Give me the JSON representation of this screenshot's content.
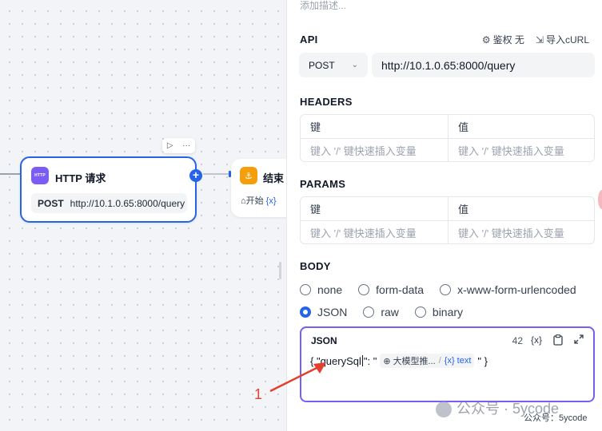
{
  "canvas": {
    "http_node": {
      "icon_label": "HTTP",
      "title": "HTTP 请求",
      "method": "POST",
      "url": "http://10.1.0.65:8000/query",
      "add_label": "+"
    },
    "toolbar": {
      "run": "▷",
      "more": "···"
    },
    "end_node": {
      "icon": "⚓",
      "title": "结束",
      "var_source": "开始",
      "var_tag": "{x}"
    }
  },
  "panel": {
    "description_placeholder": "添加描述...",
    "api": {
      "title": "API",
      "auth_label": "鉴权 无",
      "import_label": "导入cURL",
      "method": "POST",
      "url": "http://10.1.0.65:8000/query"
    },
    "headers": {
      "title": "HEADERS",
      "key_header": "键",
      "value_header": "值",
      "key_placeholder": "键入 '/' 键快速插入变量",
      "value_placeholder": "键入 '/' 键快速插入变量"
    },
    "params": {
      "title": "PARAMS",
      "key_header": "键",
      "value_header": "值",
      "key_placeholder": "键入 '/' 键快速插入变量",
      "value_placeholder": "键入 '/' 键快速插入变量"
    },
    "body": {
      "title": "BODY",
      "options": [
        "none",
        "form-data",
        "x-www-form-urlencoded",
        "JSON",
        "raw",
        "binary"
      ],
      "selected": "JSON",
      "json_editor": {
        "title": "JSON",
        "count": "42",
        "var_icon": "{x}",
        "code_prefix": "{ \"querySql",
        "code_mid": "\": \"",
        "chip_node": "大模型推...",
        "chip_var_tag": "{x}",
        "chip_var": "text",
        "code_suffix": "\" }"
      }
    }
  },
  "annotation": {
    "label": "1",
    "color": "#e53e2e"
  },
  "watermark": {
    "text": "公众号 · 5ycode",
    "text2": "公众号：5ycode"
  },
  "colors": {
    "accent": "#2563eb",
    "purple": "#7c5cf6",
    "end_icon": "#f59e0b"
  }
}
